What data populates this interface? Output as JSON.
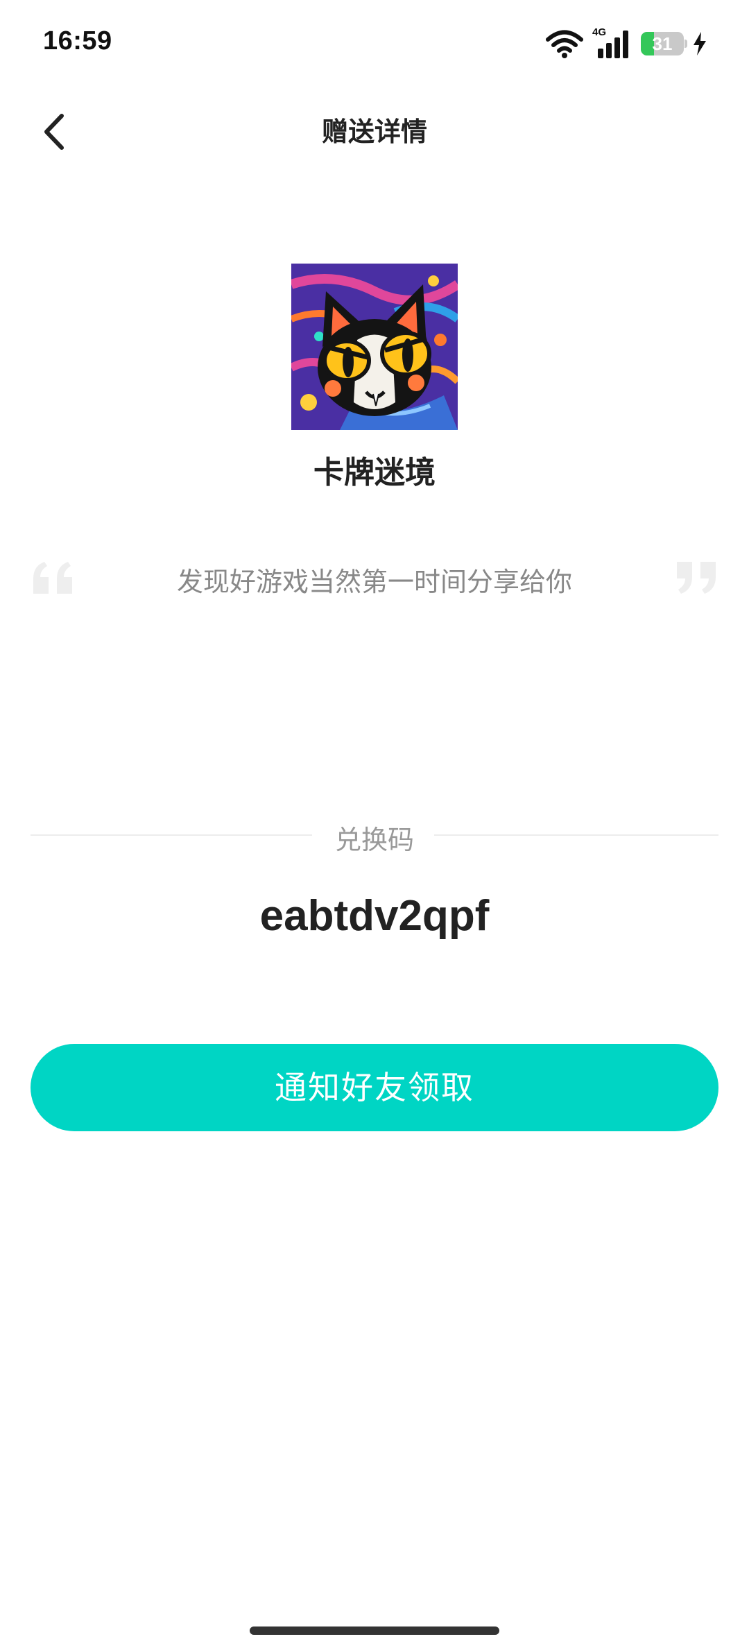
{
  "status_bar": {
    "time": "16:59",
    "network_label": "4G",
    "battery_level": "31",
    "battery_fraction": 0.31,
    "battery_color": "#34c759"
  },
  "header": {
    "title": "赠送详情",
    "back_icon": "chevron-left-icon"
  },
  "game": {
    "name": "卡牌迷境",
    "cover_icon": "cat-game-cover"
  },
  "message": {
    "text": "发现好游戏当然第一时间分享给你",
    "quote_icons": [
      "open-quote-icon",
      "close-quote-icon"
    ]
  },
  "redeem": {
    "label": "兑换码",
    "code": "eabtdv2qpf"
  },
  "actions": {
    "notify_label": "通知好友领取",
    "accent_color": "#00d5c4"
  }
}
